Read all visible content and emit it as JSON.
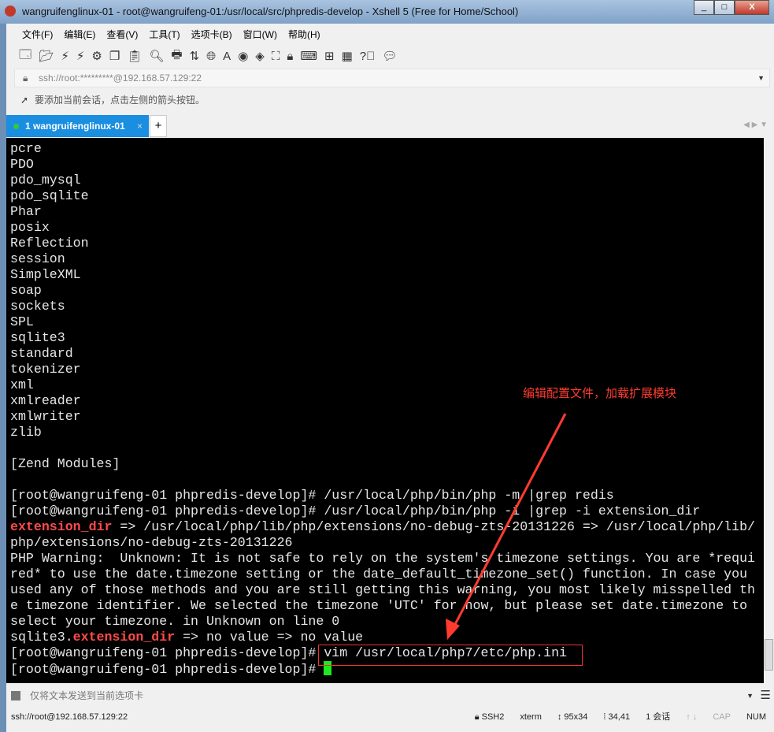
{
  "window": {
    "title": "wangruifenglinux-01 - root@wangruifeng-01:/usr/local/src/phpredis-develop - Xshell 5 (Free for Home/School)",
    "min": "_",
    "max": "□",
    "close": "X"
  },
  "menu": [
    "文件(F)",
    "编辑(E)",
    "查看(V)",
    "工具(T)",
    "选项卡(B)",
    "窗口(W)",
    "帮助(H)"
  ],
  "toolbar": [
    "new-session-icon",
    "open-icon",
    "connect-icon",
    "disconnect-icon",
    "properties-icon",
    "copy-icon",
    "paste-icon",
    "find-icon",
    "print-icon",
    "transfer-icon",
    "globe-icon",
    "font-icon",
    "xftp-icon",
    "xmanager-icon",
    "fullscreen-icon",
    "lock-icon",
    "keyboard-icon",
    "new-tab-icon",
    "layout-icon",
    "help-icon",
    "chat-icon"
  ],
  "address": {
    "value": "ssh://root:*********@192.168.57.129:22"
  },
  "hint": "要添加当前会话，点击左侧的箭头按钮。",
  "tab": {
    "label": "1 wangruifenglinux-01",
    "close": "×",
    "new": "+"
  },
  "terminal": {
    "lines": [
      [
        "pcre"
      ],
      [
        "PDO"
      ],
      [
        "pdo_mysql"
      ],
      [
        "pdo_sqlite"
      ],
      [
        "Phar"
      ],
      [
        "posix"
      ],
      [
        "Reflection"
      ],
      [
        "session"
      ],
      [
        "SimpleXML"
      ],
      [
        "soap"
      ],
      [
        "sockets"
      ],
      [
        "SPL"
      ],
      [
        "sqlite3"
      ],
      [
        "standard"
      ],
      [
        "tokenizer"
      ],
      [
        "xml"
      ],
      [
        "xmlreader"
      ],
      [
        "xmlwriter"
      ],
      [
        "zlib"
      ],
      [
        ""
      ],
      [
        "[Zend Modules]"
      ],
      [
        ""
      ],
      [
        "[root@wangruifeng-01 phpredis-develop]# /usr/local/php/bin/php -m |grep redis"
      ],
      [
        "[root@wangruifeng-01 phpredis-develop]# /usr/local/php/bin/php -i |grep -i extension_dir"
      ],
      [
        "",
        "extension_dir",
        " => /usr/local/php/lib/php/extensions/no-debug-zts-20131226 => /usr/local/php/lib/"
      ],
      [
        "php/extensions/no-debug-zts-20131226"
      ],
      [
        "PHP Warning:  Unknown: It is not safe to rely on the system's timezone settings. You are *requi"
      ],
      [
        "red* to use the date.timezone setting or the date_default_timezone_set() function. In case you"
      ],
      [
        "used any of those methods and you are still getting this warning, you most likely misspelled th"
      ],
      [
        "e timezone identifier. We selected the timezone 'UTC' for now, but please set date.timezone to"
      ],
      [
        "select your timezone. in Unknown on line 0"
      ],
      [
        "sqlite3.",
        "extension_dir",
        " => no value => no value"
      ],
      [
        "[root@wangruifeng-01 phpredis-develop]# vim /usr/local/php7/etc/php.ini"
      ],
      [
        "[root@wangruifeng-01 phpredis-develop]# "
      ]
    ],
    "cursor_color": "#1ee81e",
    "highlight_color": "#ff4a4a"
  },
  "annotation": {
    "text": "编辑配置文件，加载扩展模块",
    "color": "#ff3b30"
  },
  "sendbar": {
    "placeholder": "仅将文本发送到当前选项卡"
  },
  "status": {
    "connection": "ssh://root@192.168.57.129:22",
    "protocol": "SSH2",
    "term": "xterm",
    "size": "95x34",
    "pos": "34,41",
    "sessions": "1 会话",
    "caps": "CAP",
    "num": "NUM"
  }
}
